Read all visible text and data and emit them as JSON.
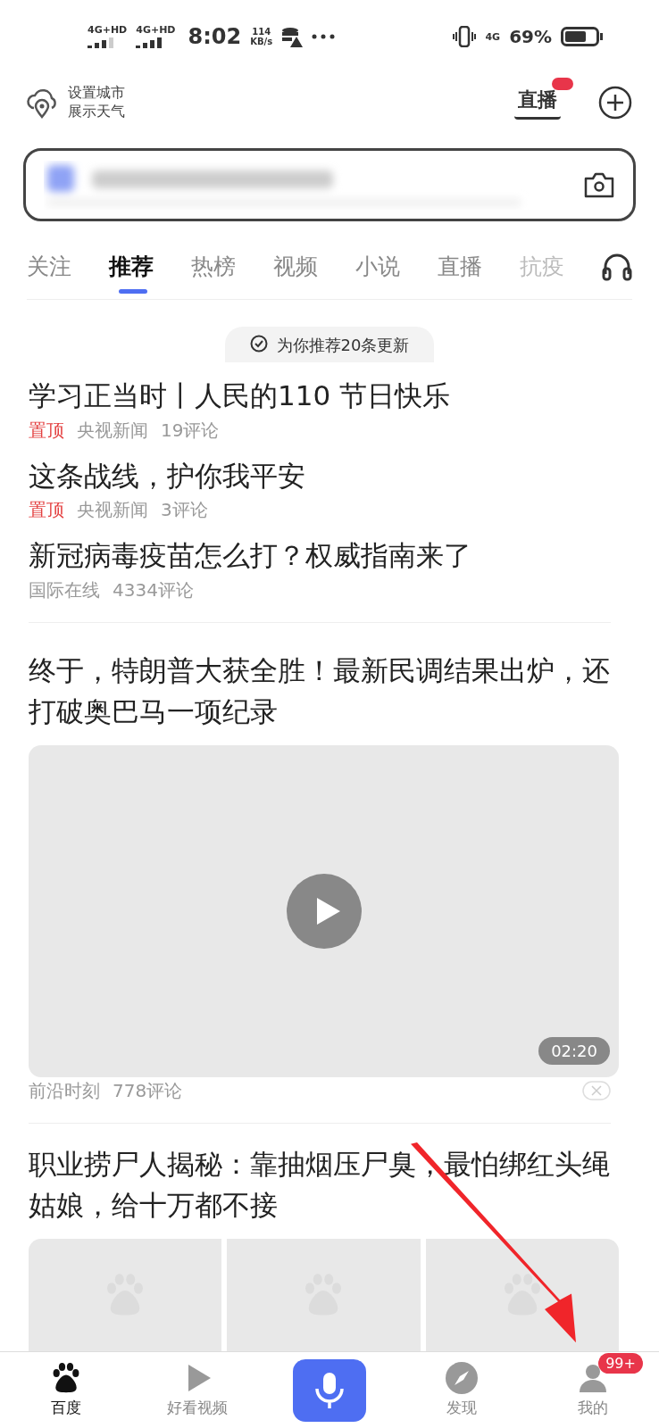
{
  "status_bar": {
    "sim1": "4G+HD",
    "sim2": "4G+HD",
    "time": "8:02",
    "speed": "114",
    "speed_unit": "KB/s",
    "network": "4G",
    "battery": "69%"
  },
  "header": {
    "weather_line1": "设置城市",
    "weather_line2": "展示天气",
    "live_label": "直播"
  },
  "tabs": [
    {
      "label": "关注",
      "selected": false
    },
    {
      "label": "推荐",
      "selected": true
    },
    {
      "label": "热榜",
      "selected": false
    },
    {
      "label": "视频",
      "selected": false
    },
    {
      "label": "小说",
      "selected": false
    },
    {
      "label": "直播",
      "selected": false
    },
    {
      "label": "抗疫",
      "selected": false
    }
  ],
  "toast": "为你推荐20条更新",
  "feed": [
    {
      "kind": "text",
      "title": "学习正当时丨人民的110 节日快乐",
      "tag": "置顶",
      "source": "央视新闻",
      "comments": "19评论"
    },
    {
      "kind": "text",
      "title": "这条战线，护你我平安",
      "tag": "置顶",
      "source": "央视新闻",
      "comments": "3评论"
    },
    {
      "kind": "text",
      "title": "新冠病毒疫苗怎么打？权威指南来了",
      "source": "国际在线",
      "comments": "4334评论"
    },
    {
      "kind": "video",
      "title": "终于，特朗普大获全胜！最新民调结果出炉，还打破奥巴马一项纪录",
      "duration": "02:20",
      "source": "前沿时刻",
      "comments": "778评论"
    },
    {
      "kind": "images",
      "title": "职业捞尸人揭秘：靠抽烟压尸臭，最怕绑红头绳姑娘，给十万都不接"
    }
  ],
  "bottom_nav": [
    {
      "kind": "paw",
      "label": "百度",
      "selected": true
    },
    {
      "kind": "play",
      "label": "好看视频",
      "selected": false
    },
    {
      "kind": "mic"
    },
    {
      "kind": "compass",
      "label": "发现",
      "selected": false
    },
    {
      "kind": "person",
      "label": "我的",
      "selected": false,
      "badge": "99+"
    }
  ]
}
